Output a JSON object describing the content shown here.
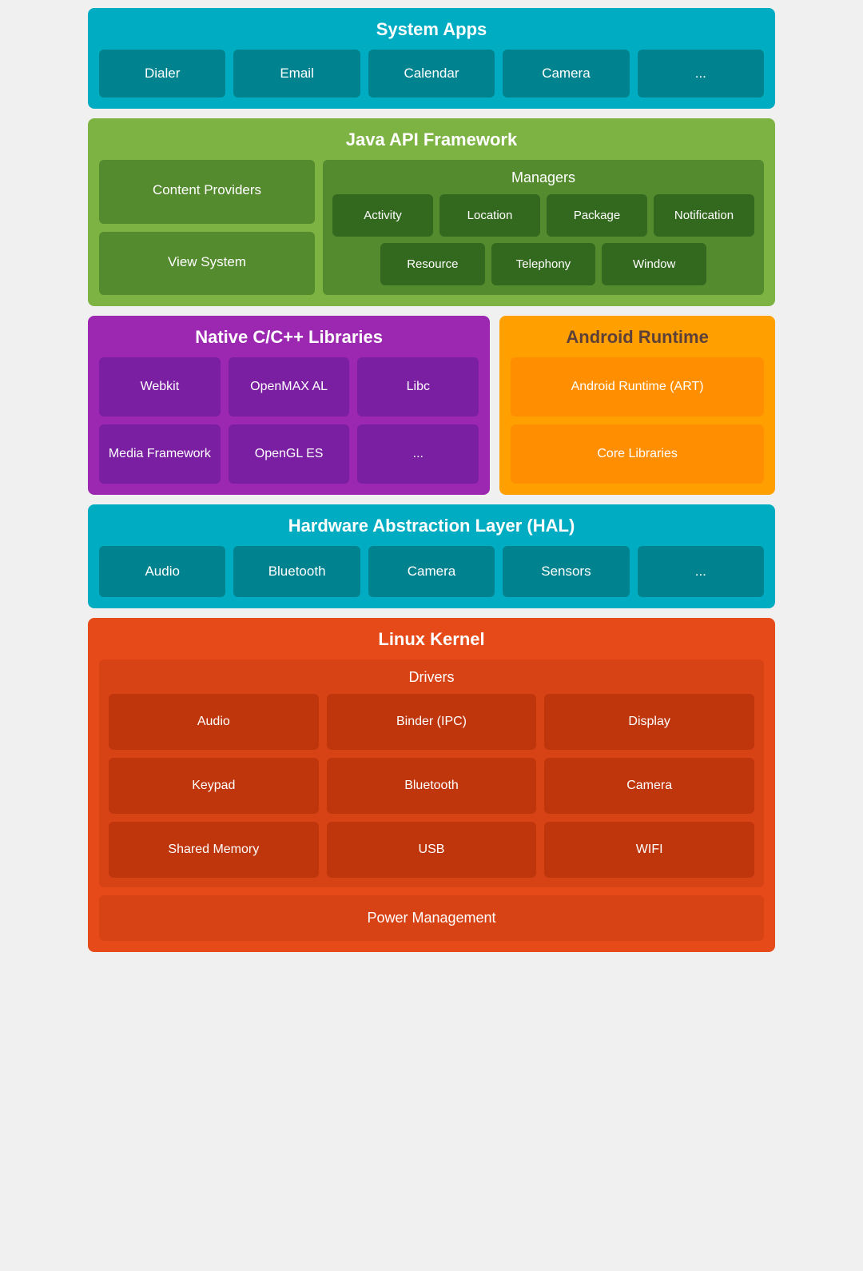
{
  "systemApps": {
    "title": "System Apps",
    "items": [
      "Dialer",
      "Email",
      "Calendar",
      "Camera",
      "..."
    ]
  },
  "javaAPI": {
    "title": "Java API Framework",
    "leftItems": [
      "Content Providers",
      "View System"
    ],
    "managers": {
      "title": "Managers",
      "row1": [
        "Activity",
        "Location",
        "Package",
        "Notification"
      ],
      "row2": [
        "Resource",
        "Telephony",
        "Window"
      ]
    }
  },
  "nativeLibs": {
    "title": "Native C/C++ Libraries",
    "items": [
      "Webkit",
      "OpenMAX AL",
      "Libc",
      "Media Framework",
      "OpenGL ES",
      "..."
    ]
  },
  "androidRuntime": {
    "title": "Android Runtime",
    "items": [
      "Android Runtime (ART)",
      "Core Libraries"
    ]
  },
  "hal": {
    "title": "Hardware Abstraction Layer (HAL)",
    "items": [
      "Audio",
      "Bluetooth",
      "Camera",
      "Sensors",
      "..."
    ]
  },
  "linuxKernel": {
    "title": "Linux Kernel",
    "drivers": {
      "title": "Drivers",
      "items": [
        "Audio",
        "Binder (IPC)",
        "Display",
        "Keypad",
        "Bluetooth",
        "Camera",
        "Shared Memory",
        "USB",
        "WIFI"
      ]
    },
    "powerMgmt": "Power Management"
  }
}
